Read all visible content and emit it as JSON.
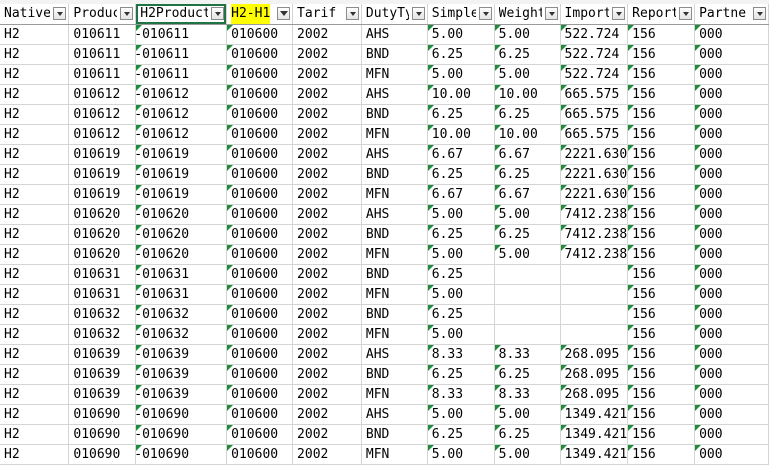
{
  "headers": [
    {
      "label": "Native",
      "filter": true
    },
    {
      "label": "Produc",
      "filter": true
    },
    {
      "label": "H2Product",
      "filter": true
    },
    {
      "label": "H2-H1",
      "filter": true
    },
    {
      "label": "Tarif",
      "filter": true
    },
    {
      "label": "DutyTy",
      "filter": true
    },
    {
      "label": "Simple",
      "filter": true
    },
    {
      "label": "Weight",
      "filter": true
    },
    {
      "label": "Import",
      "filter": true
    },
    {
      "label": "Report",
      "filter": true
    },
    {
      "label": "Partne",
      "filter": true
    }
  ],
  "rows": [
    [
      "H2",
      "010611",
      "-010611",
      "010600",
      "2002",
      "AHS",
      "5.00",
      "5.00",
      "522.724",
      "156",
      "000"
    ],
    [
      "H2",
      "010611",
      "-010611",
      "010600",
      "2002",
      "BND",
      "6.25",
      "6.25",
      "522.724",
      "156",
      "000"
    ],
    [
      "H2",
      "010611",
      "-010611",
      "010600",
      "2002",
      "MFN",
      "5.00",
      "5.00",
      "522.724",
      "156",
      "000"
    ],
    [
      "H2",
      "010612",
      "-010612",
      "010600",
      "2002",
      "AHS",
      "10.00",
      "10.00",
      "665.575",
      "156",
      "000"
    ],
    [
      "H2",
      "010612",
      "-010612",
      "010600",
      "2002",
      "BND",
      "6.25",
      "6.25",
      "665.575",
      "156",
      "000"
    ],
    [
      "H2",
      "010612",
      "-010612",
      "010600",
      "2002",
      "MFN",
      "10.00",
      "10.00",
      "665.575",
      "156",
      "000"
    ],
    [
      "H2",
      "010619",
      "-010619",
      "010600",
      "2002",
      "AHS",
      "6.67",
      "6.67",
      "2221.630",
      "156",
      "000"
    ],
    [
      "H2",
      "010619",
      "-010619",
      "010600",
      "2002",
      "BND",
      "6.25",
      "6.25",
      "2221.630",
      "156",
      "000"
    ],
    [
      "H2",
      "010619",
      "-010619",
      "010600",
      "2002",
      "MFN",
      "6.67",
      "6.67",
      "2221.630",
      "156",
      "000"
    ],
    [
      "H2",
      "010620",
      "-010620",
      "010600",
      "2002",
      "AHS",
      "5.00",
      "5.00",
      "7412.238",
      "156",
      "000"
    ],
    [
      "H2",
      "010620",
      "-010620",
      "010600",
      "2002",
      "BND",
      "6.25",
      "6.25",
      "7412.238",
      "156",
      "000"
    ],
    [
      "H2",
      "010620",
      "-010620",
      "010600",
      "2002",
      "MFN",
      "5.00",
      "5.00",
      "7412.238",
      "156",
      "000"
    ],
    [
      "H2",
      "010631",
      "-010631",
      "010600",
      "2002",
      "BND",
      "6.25",
      "",
      "",
      "156",
      "000"
    ],
    [
      "H2",
      "010631",
      "-010631",
      "010600",
      "2002",
      "MFN",
      "5.00",
      "",
      "",
      "156",
      "000"
    ],
    [
      "H2",
      "010632",
      "-010632",
      "010600",
      "2002",
      "BND",
      "6.25",
      "",
      "",
      "156",
      "000"
    ],
    [
      "H2",
      "010632",
      "-010632",
      "010600",
      "2002",
      "MFN",
      "5.00",
      "",
      "",
      "156",
      "000"
    ],
    [
      "H2",
      "010639",
      "-010639",
      "010600",
      "2002",
      "AHS",
      "8.33",
      "8.33",
      "268.095",
      "156",
      "000"
    ],
    [
      "H2",
      "010639",
      "-010639",
      "010600",
      "2002",
      "BND",
      "6.25",
      "6.25",
      "268.095",
      "156",
      "000"
    ],
    [
      "H2",
      "010639",
      "-010639",
      "010600",
      "2002",
      "MFN",
      "8.33",
      "8.33",
      "268.095",
      "156",
      "000"
    ],
    [
      "H2",
      "010690",
      "-010690",
      "010600",
      "2002",
      "AHS",
      "5.00",
      "5.00",
      "1349.421",
      "156",
      "000"
    ],
    [
      "H2",
      "010690",
      "-010690",
      "010600",
      "2002",
      "BND",
      "6.25",
      "6.25",
      "1349.421",
      "156",
      "000"
    ],
    [
      "H2",
      "010690",
      "-010690",
      "010600",
      "2002",
      "MFN",
      "5.00",
      "5.00",
      "1349.421",
      "156",
      "000"
    ]
  ],
  "colors": {
    "highlight": "#ffff00",
    "active_border": "#217346",
    "error_triangle": "#1e8c3a",
    "grid": "#d4d4d4"
  }
}
